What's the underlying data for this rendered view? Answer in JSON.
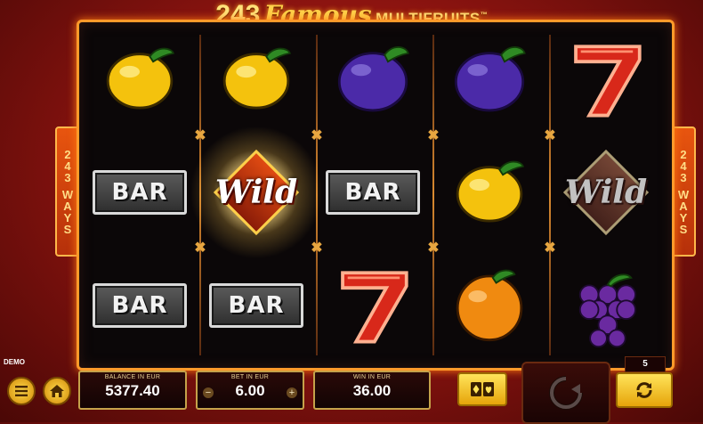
{
  "title": {
    "number": "243",
    "famous": "Famous",
    "multi": "MULTIFRUITS",
    "tm": "™"
  },
  "ways": {
    "lines": [
      "2",
      "4",
      "3",
      "W",
      "A",
      "Y",
      "S"
    ]
  },
  "reels": [
    [
      "lemon",
      "bar",
      "bar"
    ],
    [
      "lemon",
      "wild",
      "bar"
    ],
    [
      "plum",
      "bar",
      "seven"
    ],
    [
      "plum",
      "lemon",
      "orange"
    ],
    [
      "seven",
      "wild",
      "grapes"
    ]
  ],
  "symbols": {
    "bar_label": "BAR",
    "wild_label": "Wild"
  },
  "hud": {
    "demo": "DEMO",
    "balance_label": "BALANCE IN EUR",
    "balance_value": "5377.40",
    "bet_label": "BET IN EUR",
    "bet_value": "6.00",
    "bet_minus": "−",
    "bet_plus": "+",
    "win_label": "WIN IN EUR",
    "win_value": "36.00",
    "autoplay_count": "5"
  },
  "colors": {
    "frame": "#ff9a2a",
    "accent": "#ffd24a",
    "background": "#8e1410"
  }
}
